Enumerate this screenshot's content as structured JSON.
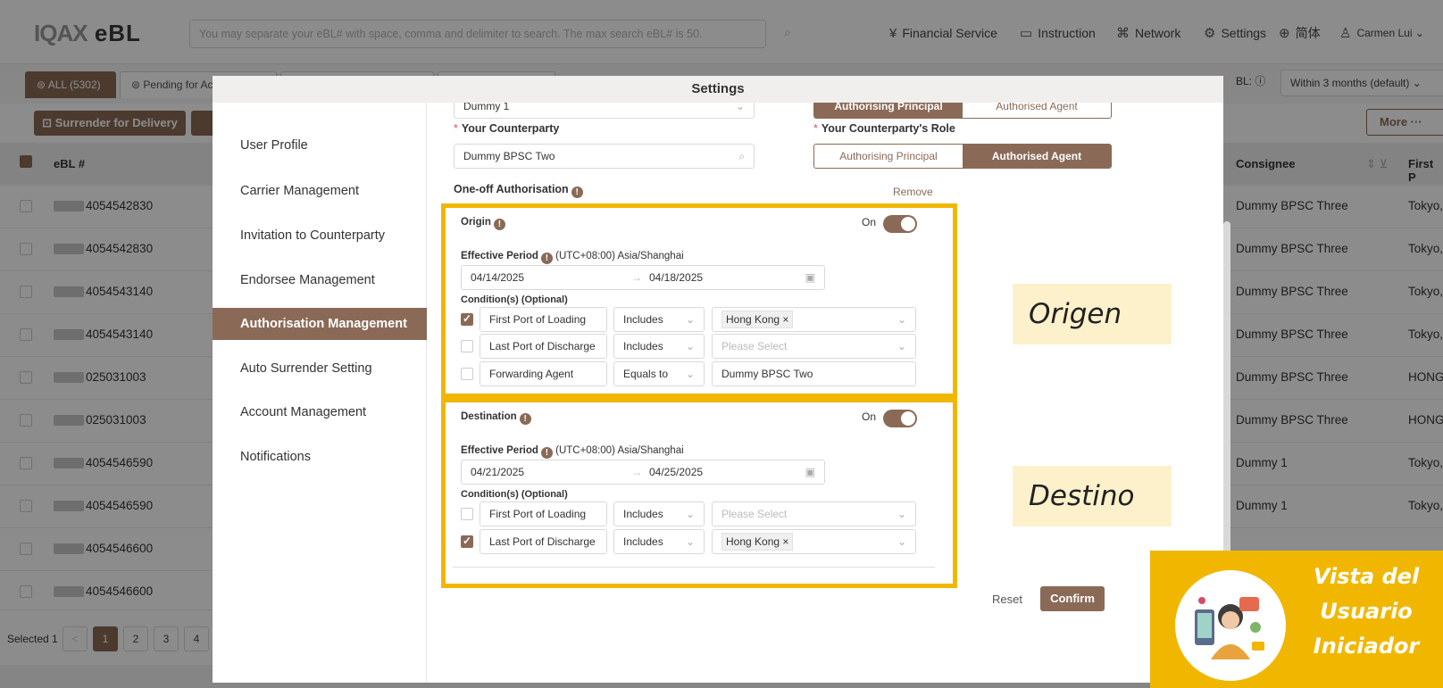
{
  "app": {
    "logo": "eBL",
    "logo_mark": "IQAX",
    "search_placeholder": "You may separate your eBL# with space, comma and delimiter to search. The max search eBL# is 50.",
    "nav": [
      {
        "icon": "¥",
        "label": "Financial Service"
      },
      {
        "icon": "▭",
        "label": "Instruction"
      },
      {
        "icon": "⌘",
        "label": "Network"
      },
      {
        "icon": "⚙",
        "label": "Settings"
      },
      {
        "icon": "⊕",
        "label": "简体"
      },
      {
        "icon": "♙",
        "label": "Carmen Lui ⌄"
      }
    ]
  },
  "tabs": {
    "all": "⊜ ALL (5302)",
    "pending": "⊜ Pending for Ac"
  },
  "filter": {
    "label": "BL: ⓘ",
    "value": "Within 3 months (default)    ⌄"
  },
  "actions": {
    "surrender": "⊡ Surrender for Delivery",
    "more": "More ···"
  },
  "table": {
    "headers": {
      "ebl": "eBL #",
      "consignee": "Consignee",
      "first_port": "First P"
    },
    "rows": [
      {
        "ebl": "4054542830",
        "consignee": "Dummy BPSC Three",
        "port": "Tokyo,"
      },
      {
        "ebl": "4054542830",
        "consignee": "Dummy BPSC Three",
        "port": "Tokyo,"
      },
      {
        "ebl": "4054543140",
        "consignee": "Dummy BPSC Three",
        "port": "Tokyo,"
      },
      {
        "ebl": "4054543140",
        "consignee": "Dummy BPSC Three",
        "port": "Tokyo,"
      },
      {
        "ebl": "025031003",
        "consignee": "Dummy BPSC Three",
        "port": "HONG"
      },
      {
        "ebl": "025031003",
        "consignee": "Dummy BPSC Three",
        "port": "HONG"
      },
      {
        "ebl": "4054546590",
        "consignee": "Dummy 1",
        "port": "Tokyo,"
      },
      {
        "ebl": "4054546590",
        "consignee": "Dummy 1",
        "port": "Tokyo,"
      },
      {
        "ebl": "4054546600",
        "consignee": "",
        "port": ""
      },
      {
        "ebl": "4054546600",
        "consignee": "",
        "port": ""
      }
    ],
    "selected": "Selected 1",
    "pages": [
      "1",
      "2",
      "3",
      "4"
    ]
  },
  "modal": {
    "title": "Settings",
    "menu": [
      "User Profile",
      "Carrier Management",
      "Invitation to Counterparty",
      "Endorsee Management",
      "Authorisation Management",
      "Auto Surrender Setting",
      "Account Management",
      "Notifications"
    ],
    "top_input_value": "Dummy 1",
    "role_top": {
      "principal": "Authorising Principal",
      "agent": "Authorised Agent"
    },
    "counterparty_label": "Your Counterparty",
    "counterparty_value": "Dummy BPSC Two",
    "counterparty_role_label": "Your Counterparty's Role",
    "role": {
      "principal": "Authorising Principal",
      "agent": "Authorised Agent"
    },
    "oneoff_label": "One-off Authorisation",
    "remove": "Remove",
    "origin": {
      "title": "Origin",
      "toggle_label": "On",
      "period_label": "Effective Period",
      "timezone": "(UTC+08:00) Asia/Shanghai",
      "start": "04/14/2025",
      "end": "04/18/2025",
      "conditions_label": "Condition(s) (Optional)",
      "conditions": [
        {
          "field": "First Port of Loading",
          "op": "Includes",
          "value": "Hong Kong",
          "checked": true
        },
        {
          "field": "Last Port of Discharge",
          "op": "Includes",
          "value": "Please Select",
          "checked": false
        },
        {
          "field": "Forwarding Agent",
          "op": "Equals to",
          "value": "Dummy BPSC Two",
          "checked": false
        }
      ]
    },
    "destination": {
      "title": "Destination",
      "toggle_label": "On",
      "period_label": "Effective Period",
      "timezone": "(UTC+08:00) Asia/Shanghai",
      "start": "04/21/2025",
      "end": "04/25/2025",
      "conditions_label": "Condition(s) (Optional)",
      "conditions": [
        {
          "field": "First Port of Loading",
          "op": "Includes",
          "value": "Please Select",
          "checked": false
        },
        {
          "field": "Last Port of Discharge",
          "op": "Includes",
          "value": "Hong Kong",
          "checked": true
        }
      ]
    },
    "reset": "Reset",
    "confirm": "Confirm"
  },
  "callouts": {
    "origin": "Origen",
    "destination": "Destino",
    "corner_lines": [
      "Vista del",
      "Usuario",
      "Iniciador"
    ]
  },
  "colors": {
    "brand": "#8a6a57",
    "highlight": "#f1b700",
    "callout_bg": "#fdf1cc"
  }
}
